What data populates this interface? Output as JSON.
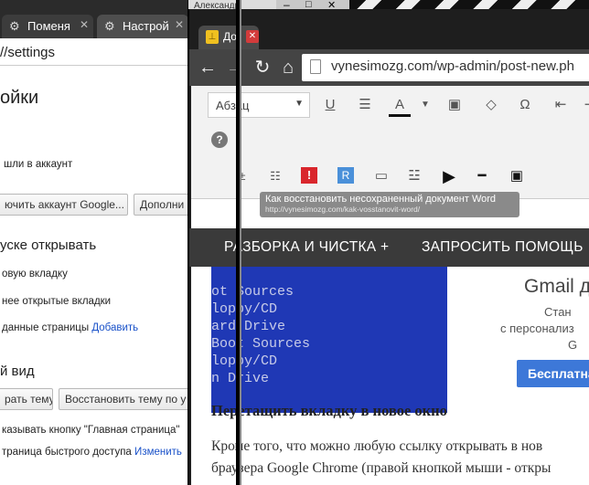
{
  "back_window": {
    "tabs": [
      {
        "label": "Поменя",
        "icon": "gear-icon"
      },
      {
        "label": "Настрой",
        "icon": "gear-icon"
      }
    ],
    "user_tab": "Александр",
    "address": "//settings",
    "heading_settings": "ойки",
    "signed_in_text": "шли в аккаунт",
    "disconnect_button": "ючить аккаунт Google...",
    "advanced_button": "Дополни",
    "startup_heading": "уске открывать",
    "startup_opt1": "овую вкладку",
    "startup_opt2": "нее открытые вкладки",
    "startup_opt3": "данные страницы",
    "startup_add_link": "Добавить",
    "appearance_heading": "й вид",
    "theme_button": "рать тему",
    "restore_theme_button": "Восстановить тему по у",
    "home_button_text": "казывать кнопку \"Главная страница\"",
    "quick_access_text": "траница быстрого доступа",
    "quick_access_link": "Изменить"
  },
  "front_window": {
    "tab_icon": "bookmark-icon",
    "tab_label": "До",
    "tab_close": "✕",
    "omnibox": "vynesimozg.com/wp-admin/post-new.ph",
    "editor": {
      "paragraph_select": "Абзац",
      "toolbar_icons": [
        "underline-icon",
        "justify-icon",
        "text-color-icon",
        "paste-text-icon",
        "eraser-icon",
        "omega-icon",
        "outdent-icon"
      ],
      "toolbar2_icons": [
        "help-icon"
      ],
      "toolbar3_icons": [
        "list-icon",
        "alert-icon",
        "plugin-icon",
        "window-icon",
        "table-icon",
        "play-icon",
        "slider-icon",
        "video-icon"
      ]
    },
    "tooltip_title": "Как восстановить несохраненный документ Word",
    "tooltip_url": "http://vynesimozg.com/kak-vosstanovit-word/",
    "menu1": "РАЗБОРКА И ЧИСТКА +",
    "menu2": "ЗАПРОСИТЬ ПОМОЩЬ",
    "bios_lines": [
      "ot Sources",
      "loppy/CD",
      "ard Drive",
      "Boot Sources",
      "loppy/CD",
      "n Drive"
    ],
    "gmail_title": "Gmail д",
    "gmail_line1": "Стан",
    "gmail_line2": "с персонализ",
    "gmail_line3": "G",
    "gmail_button": "Бесплатна",
    "article_heading": "Перетащить вкладку в новое окно",
    "article_line1": "Кроме того, что можно любую ссылку открывать в нов",
    "article_line2": "браузера Google Chrome (правой кнопкой мыши - откры"
  }
}
